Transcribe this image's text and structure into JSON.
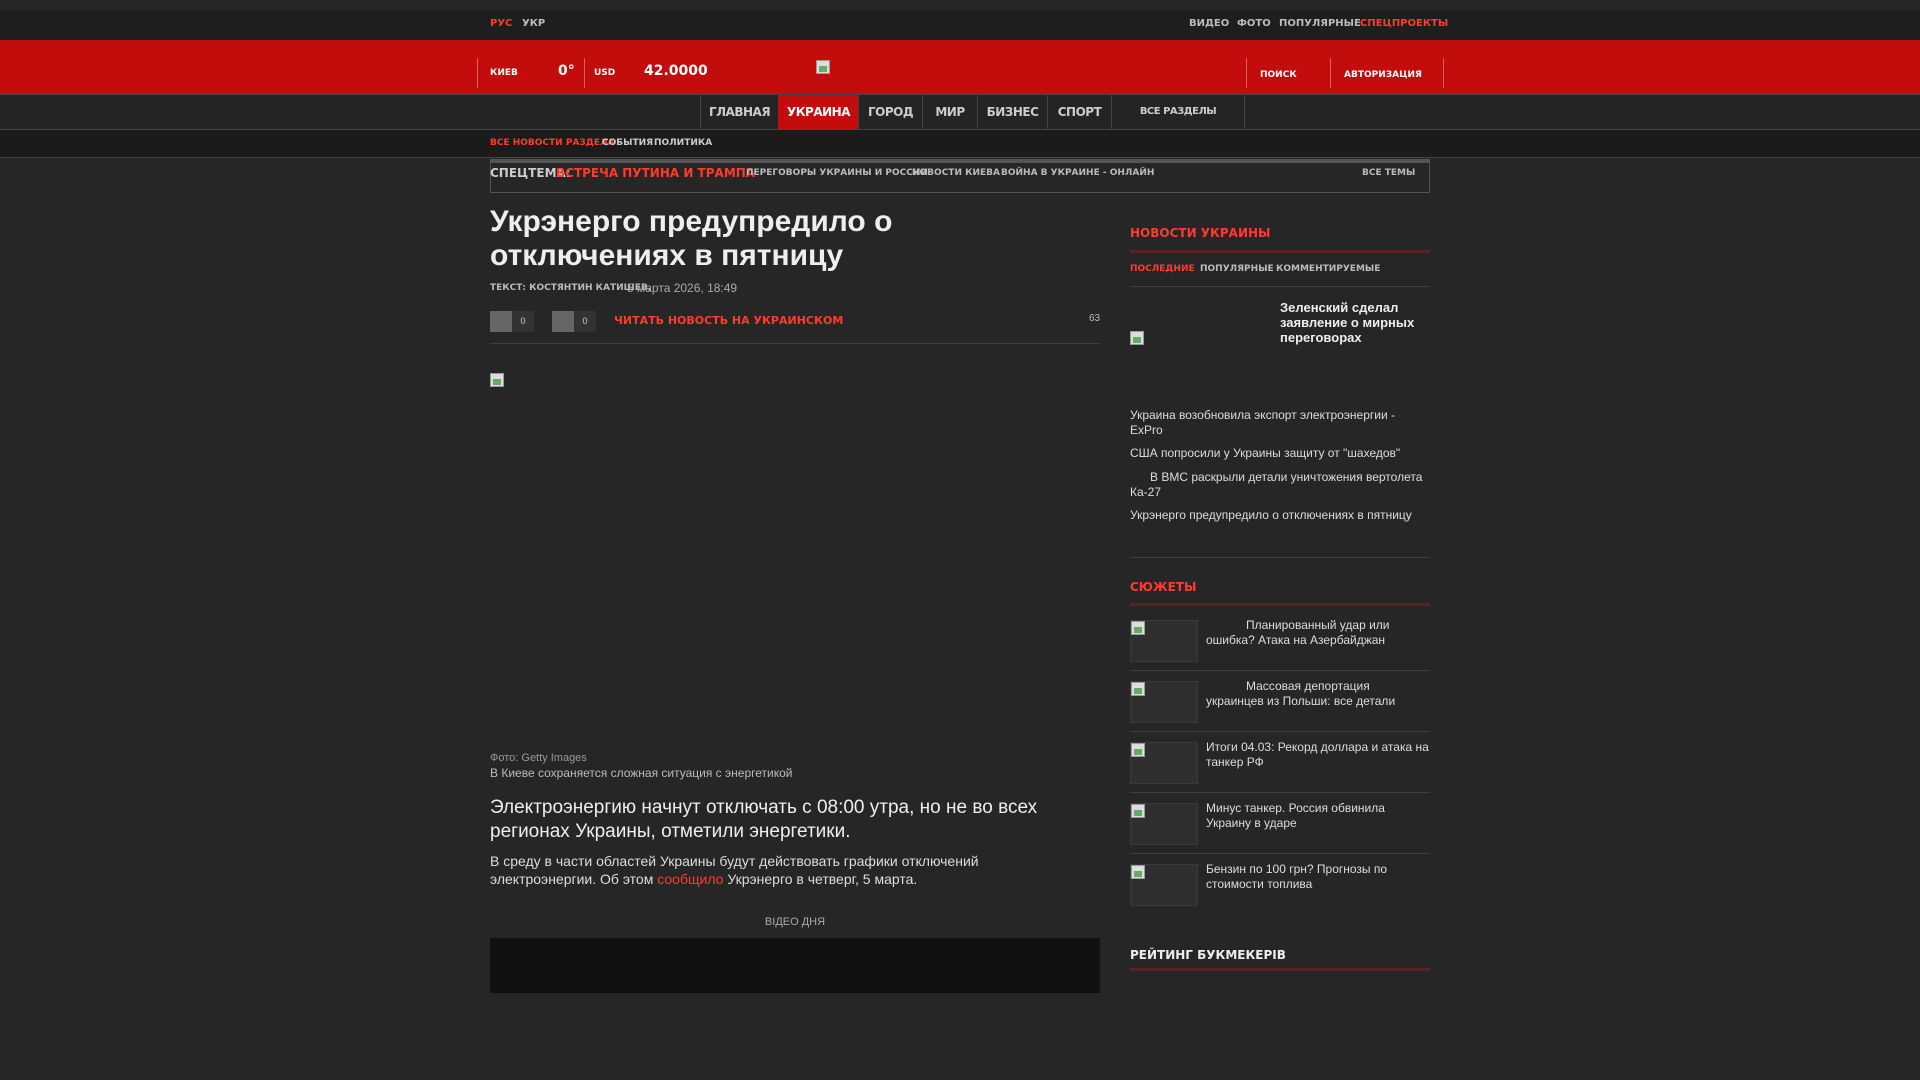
{
  "topbar": {
    "lang_ru": "РУС",
    "lang_uk": "УКР",
    "links": [
      "ВИДЕО",
      "ФОТО",
      "ПОПУЛЯРНЫЕ",
      "СПЕЦПРОЕКТЫ"
    ]
  },
  "header": {
    "city": "КИЕВ",
    "temp": "0°",
    "currency": "USD",
    "rate": "42.0000",
    "search": "ПОИСК",
    "auth": "АВТОРИЗАЦИЯ"
  },
  "nav": {
    "items": [
      "ГЛАВНАЯ",
      "УКРАИНА",
      "ГОРОД",
      "МИР",
      "БИЗНЕС",
      "СПОРТ"
    ],
    "all_sections": "ВСЕ РАЗДЕЛЫ"
  },
  "subnav": {
    "all_news": "ВСЕ НОВОСТИ РАЗДЕЛА",
    "events": "СОБЫТИЯ",
    "politics": "ПОЛИТИКА"
  },
  "special": {
    "label": "СПЕЦТЕМА:",
    "topic": "ВСТРЕЧА ПУТИНА И ТРАМПА",
    "links": [
      "ПЕРЕГОВОРЫ УКРАИНЫ И РОССИИ",
      "НОВОСТИ КИЕВА",
      "ВОЙНА В УКРАИНЕ - ОНЛАЙН"
    ],
    "all_topics": "ВСЕ ТЕМЫ"
  },
  "article": {
    "title": "Укрэнерго предупредило о отключениях в пятницу",
    "author": "ТЕКСТ: КОСТЯНТИН КАТИШЕВ,",
    "date": "5 марта 2026, 18:49",
    "share1_count": "0",
    "share2_count": "0",
    "read_ukr": "ЧИТАТЬ НОВОСТЬ НА УКРАИНСКОМ",
    "comments": "63",
    "photo_credit": "Фото: Getty Images",
    "photo_caption": "В Киеве сохраняется сложная ситуация с энергетикой",
    "lead": "Электроэнергию начнут отключать с 08:00 утра, но не во всех регионах Украины, отметили энергетики.",
    "body_before": "В среду в части областей Украины будут действовать графики отключений электроэнергии. Об этом ",
    "body_link": "сообщило",
    "body_after": " Укрэнерго в четверг, 5 марта.",
    "video_label": "ВІДЕО ДНЯ"
  },
  "sidebar": {
    "news_title": "НОВОСТИ УКРАИНЫ",
    "tabs": [
      "ПОСЛЕДНИЕ",
      "ПОПУЛЯРНЫЕ",
      "КОММЕНТИРУЕМЫЕ"
    ],
    "featured": "Зеленский сделал заявление о мирных переговорах",
    "news": [
      "Украина возобновила экспорт электроэнергии - ExPro",
      "США попросили у Украины защиту от \"шахедов\"",
      "В ВМС раскрыли детали уничтожения вертолета Ка-27",
      "Укрэнерго предупредило о отключениях в пятницу"
    ],
    "stories_title": "СЮЖЕТЫ",
    "stories": [
      "Планированный удар или ошибка? Атака на Азербайджан",
      "Массовая депортация украинцев из Польши: все детали",
      "Итоги 04.03: Рекорд доллара и атака на танкер РФ",
      "Минус танкер. Россия обвинила Украину в ударе",
      "Бензин по 100 грн? Прогнозы по стоимости топлива"
    ],
    "rating_title": "РЕЙТИНГ БУКМЕКЕРІВ"
  },
  "colors": {
    "accent": "#c30c0c",
    "link": "#ff3b2d",
    "bg": "#262626"
  }
}
